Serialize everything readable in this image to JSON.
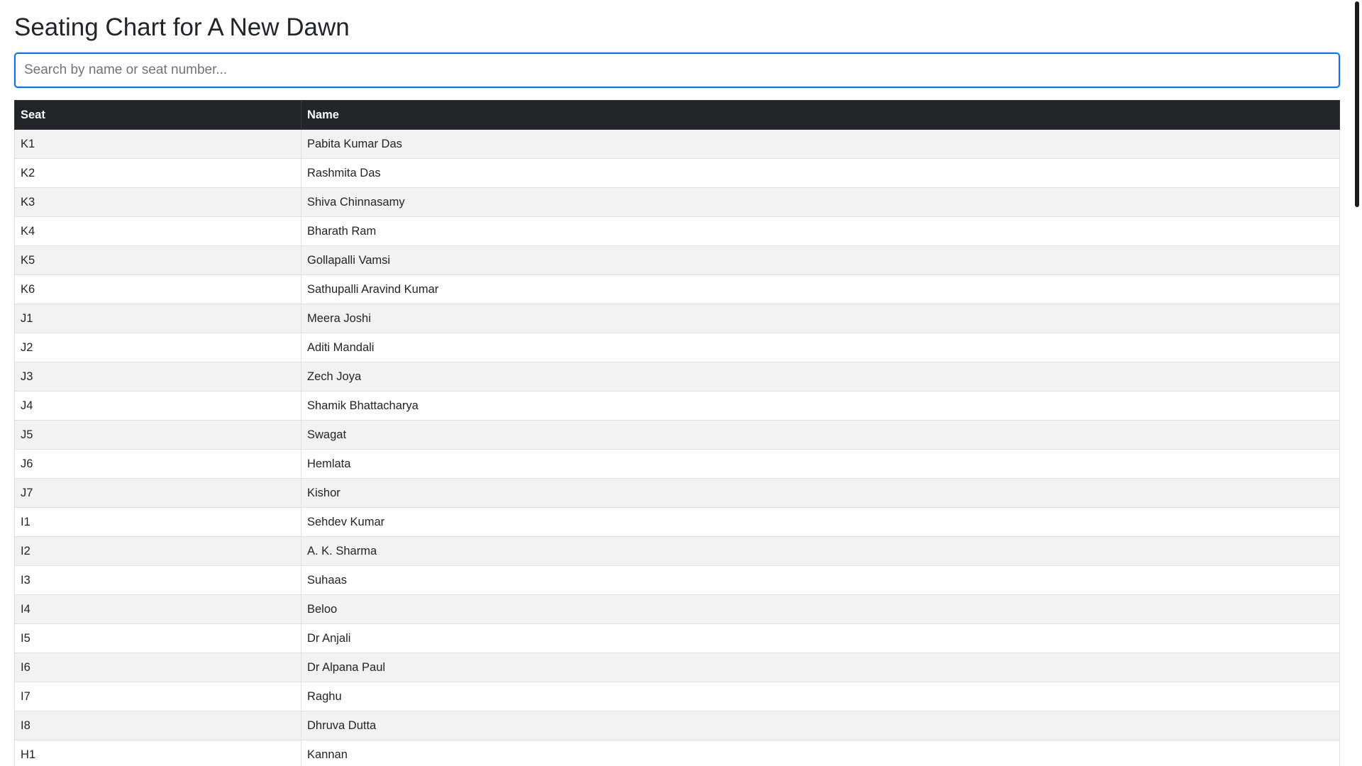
{
  "page": {
    "title": "Seating Chart for A New Dawn"
  },
  "search": {
    "placeholder": "Search by name or seat number...",
    "value": ""
  },
  "table": {
    "columns": [
      "Seat",
      "Name"
    ],
    "rows": [
      {
        "seat": "K1",
        "name": "Pabita Kumar Das"
      },
      {
        "seat": "K2",
        "name": "Rashmita Das"
      },
      {
        "seat": "K3",
        "name": "Shiva Chinnasamy"
      },
      {
        "seat": "K4",
        "name": "Bharath Ram"
      },
      {
        "seat": "K5",
        "name": "Gollapalli Vamsi"
      },
      {
        "seat": "K6",
        "name": "Sathupalli Aravind Kumar"
      },
      {
        "seat": "J1",
        "name": "Meera Joshi"
      },
      {
        "seat": "J2",
        "name": "Aditi Mandali"
      },
      {
        "seat": "J3",
        "name": "Zech Joya"
      },
      {
        "seat": "J4",
        "name": "Shamik Bhattacharya"
      },
      {
        "seat": "J5",
        "name": "Swagat"
      },
      {
        "seat": "J6",
        "name": "Hemlata"
      },
      {
        "seat": "J7",
        "name": "Kishor"
      },
      {
        "seat": "I1",
        "name": "Sehdev Kumar"
      },
      {
        "seat": "I2",
        "name": "A. K. Sharma"
      },
      {
        "seat": "I3",
        "name": "Suhaas"
      },
      {
        "seat": "I4",
        "name": "Beloo"
      },
      {
        "seat": "I5",
        "name": "Dr Anjali"
      },
      {
        "seat": "I6",
        "name": "Dr Alpana Paul"
      },
      {
        "seat": "I7",
        "name": "Raghu"
      },
      {
        "seat": "I8",
        "name": "Dhruva Dutta"
      },
      {
        "seat": "H1",
        "name": "Kannan"
      }
    ]
  },
  "colors": {
    "header_bg": "#212529",
    "stripe_bg": "#f2f2f2",
    "focus_border": "#0d6efd"
  }
}
